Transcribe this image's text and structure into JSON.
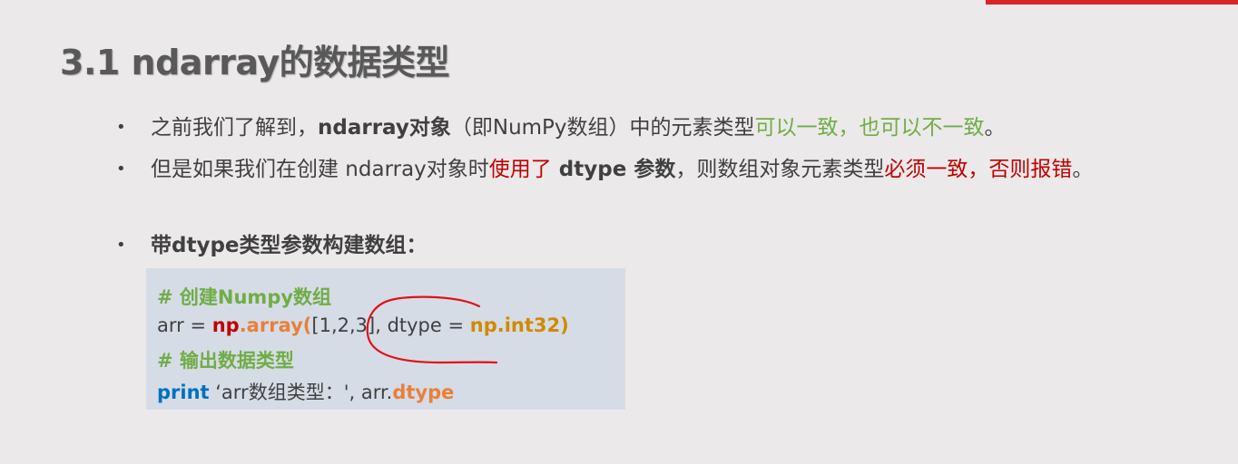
{
  "title": "3.1 ndarray的数据类型",
  "colors": {
    "accent_bar": "#d6262a",
    "green": "#70ad47",
    "red": "#c00000",
    "code_bg": "#d6dce5",
    "keyword_blue": "#0070c0",
    "orange": "#e8803a"
  },
  "bullets": [
    {
      "marker": "•",
      "p1": "之前我们了解到，",
      "p2": "ndarray对象",
      "p3": "（即NumPy数组）中的元素类型",
      "p4": "可以一致，也可以不一致",
      "p5": "。"
    },
    {
      "marker": "•",
      "p1": "但是如果我们在创建 ndarray对象时",
      "p2": "使用了",
      "p3": " dtype 参数",
      "p4": "，则数组对象元素类型",
      "p5": "必须一致，否则报错",
      "p6": "。"
    },
    {
      "marker": "•",
      "p1": "带dtype类型参数构建数组："
    }
  ],
  "code": {
    "line1": "# 创建Numpy数组",
    "line2": {
      "a": "arr = ",
      "b": "np",
      "c": ".array(",
      "d": "[1,2,3]",
      "e": ", dtype = ",
      "f": "np.int32)"
    },
    "line3": "# 输出数据类型",
    "line4": {
      "a": "print",
      "b": "  ‘arr数组类型：', arr.",
      "c": "dtype"
    }
  },
  "annotation_color": "#e0111b"
}
